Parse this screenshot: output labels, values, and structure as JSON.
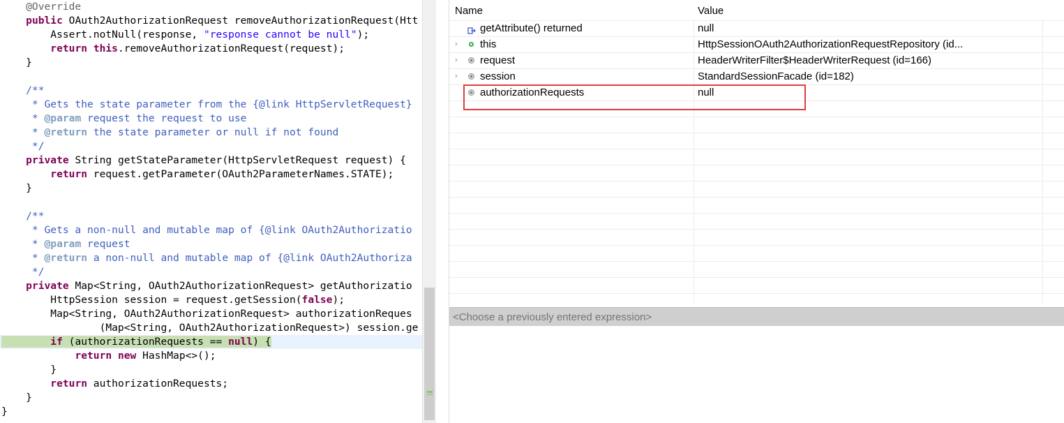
{
  "editor": {
    "lines": [
      {
        "parts": [
          {
            "c": "an",
            "t": "    @Override"
          }
        ]
      },
      {
        "parts": [
          {
            "c": "",
            "t": "    "
          },
          {
            "c": "kw",
            "t": "public"
          },
          {
            "c": "",
            "t": " OAuth2AuthorizationRequest removeAuthorizationRequest(Htt"
          }
        ]
      },
      {
        "parts": [
          {
            "c": "",
            "t": "        Assert.notNull(response, "
          },
          {
            "c": "st",
            "t": "\"response cannot be null\""
          },
          {
            "c": "",
            "t": ");"
          }
        ]
      },
      {
        "parts": [
          {
            "c": "",
            "t": "        "
          },
          {
            "c": "kw",
            "t": "return"
          },
          {
            "c": "",
            "t": " "
          },
          {
            "c": "kw",
            "t": "this"
          },
          {
            "c": "",
            "t": ".removeAuthorizationRequest(request);"
          }
        ]
      },
      {
        "parts": [
          {
            "c": "",
            "t": "    }"
          }
        ]
      },
      {
        "parts": [
          {
            "c": "",
            "t": ""
          }
        ]
      },
      {
        "parts": [
          {
            "c": "cm",
            "t": "    /**"
          }
        ]
      },
      {
        "parts": [
          {
            "c": "cm",
            "t": "     * Gets the state parameter from the {@link HttpServletRequest}"
          }
        ]
      },
      {
        "parts": [
          {
            "c": "cm",
            "t": "     * "
          },
          {
            "c": "tg",
            "t": "@param"
          },
          {
            "c": "cm",
            "t": " request the request to use"
          }
        ]
      },
      {
        "parts": [
          {
            "c": "cm",
            "t": "     * "
          },
          {
            "c": "tg",
            "t": "@return"
          },
          {
            "c": "cm",
            "t": " the state parameter or null if not found"
          }
        ]
      },
      {
        "parts": [
          {
            "c": "cm",
            "t": "     */"
          }
        ]
      },
      {
        "parts": [
          {
            "c": "",
            "t": "    "
          },
          {
            "c": "kw",
            "t": "private"
          },
          {
            "c": "",
            "t": " String getStateParameter(HttpServletRequest request) {"
          }
        ]
      },
      {
        "parts": [
          {
            "c": "",
            "t": "        "
          },
          {
            "c": "kw",
            "t": "return"
          },
          {
            "c": "",
            "t": " request.getParameter(OAuth2ParameterNames.STATE);"
          }
        ]
      },
      {
        "parts": [
          {
            "c": "",
            "t": "    }"
          }
        ]
      },
      {
        "parts": [
          {
            "c": "",
            "t": ""
          }
        ]
      },
      {
        "parts": [
          {
            "c": "cm",
            "t": "    /**"
          }
        ]
      },
      {
        "parts": [
          {
            "c": "cm",
            "t": "     * Gets a non-null and mutable map of {@link OAuth2Authorizatio"
          }
        ]
      },
      {
        "parts": [
          {
            "c": "cm",
            "t": "     * "
          },
          {
            "c": "tg",
            "t": "@param"
          },
          {
            "c": "cm",
            "t": " request"
          }
        ]
      },
      {
        "parts": [
          {
            "c": "cm",
            "t": "     * "
          },
          {
            "c": "tg",
            "t": "@return"
          },
          {
            "c": "cm",
            "t": " a non-null and mutable map of {@link OAuth2Authoriza"
          }
        ]
      },
      {
        "parts": [
          {
            "c": "cm",
            "t": "     */"
          }
        ]
      },
      {
        "parts": [
          {
            "c": "",
            "t": "    "
          },
          {
            "c": "kw",
            "t": "private"
          },
          {
            "c": "",
            "t": " Map<String, OAuth2AuthorizationRequest> getAuthorizatio"
          }
        ]
      },
      {
        "parts": [
          {
            "c": "",
            "t": "        HttpSession session = request.getSession("
          },
          {
            "c": "kw",
            "t": "false"
          },
          {
            "c": "",
            "t": ");"
          }
        ]
      },
      {
        "parts": [
          {
            "c": "",
            "t": "        Map<String, OAuth2AuthorizationRequest> authorizationReques"
          }
        ]
      },
      {
        "parts": [
          {
            "c": "",
            "t": "                (Map<String, OAuth2AuthorizationRequest>) session.ge"
          }
        ]
      },
      {
        "highlight": true,
        "parts": [
          {
            "c": "",
            "t": "        "
          },
          {
            "c": "kw",
            "t": "if"
          },
          {
            "c": "",
            "t": " (authorizationRequests == "
          },
          {
            "c": "kw",
            "t": "null"
          },
          {
            "c": "",
            "t": ") {"
          }
        ]
      },
      {
        "parts": [
          {
            "c": "",
            "t": "            "
          },
          {
            "c": "kw",
            "t": "return"
          },
          {
            "c": "",
            "t": " "
          },
          {
            "c": "kw",
            "t": "new"
          },
          {
            "c": "",
            "t": " HashMap<>();"
          }
        ]
      },
      {
        "parts": [
          {
            "c": "",
            "t": "        }"
          }
        ]
      },
      {
        "parts": [
          {
            "c": "",
            "t": "        "
          },
          {
            "c": "kw",
            "t": "return"
          },
          {
            "c": "",
            "t": " authorizationRequests;"
          }
        ]
      },
      {
        "parts": [
          {
            "c": "",
            "t": "    }"
          }
        ]
      },
      {
        "parts": [
          {
            "c": "",
            "t": "}"
          }
        ]
      }
    ]
  },
  "variables": {
    "columns": {
      "name": "Name",
      "value": "Value"
    },
    "rows": [
      {
        "icon": "return-value-icon",
        "expandable": false,
        "name": "getAttribute() returned",
        "value": "null"
      },
      {
        "icon": "public-field-icon",
        "expandable": true,
        "name": "this",
        "value": "HttpSessionOAuth2AuthorizationRequestRepository  (id..."
      },
      {
        "icon": "protected-field-icon",
        "expandable": true,
        "name": "request",
        "value": "HeaderWriterFilter$HeaderWriterRequest  (id=166)"
      },
      {
        "icon": "protected-field-icon",
        "expandable": true,
        "name": "session",
        "value": "StandardSessionFacade  (id=182)"
      },
      {
        "icon": "protected-field-icon",
        "expandable": false,
        "name": "authorizationRequests",
        "value": "null"
      }
    ]
  },
  "expression": {
    "placeholder": "<Choose a previously entered expression>"
  },
  "colors": {
    "keyword": "#7f0055",
    "string": "#2a00ff",
    "comment": "#3f5fbf",
    "highlight_line": "#c8dfb3",
    "annotation_box": "#e23b3b"
  }
}
